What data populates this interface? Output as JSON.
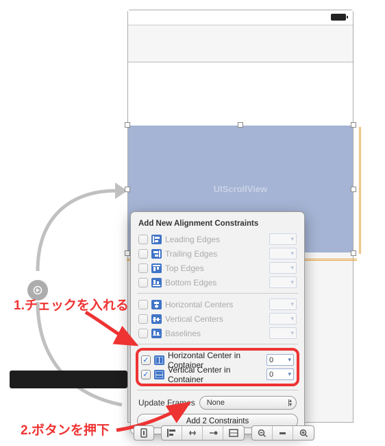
{
  "canvas": {
    "element_label": "UIScrollView"
  },
  "popover": {
    "title": "Add New Alignment Constraints",
    "options": [
      {
        "label": "Leading Edges",
        "checked": false,
        "enabled": false,
        "value": ""
      },
      {
        "label": "Trailing Edges",
        "checked": false,
        "enabled": false,
        "value": ""
      },
      {
        "label": "Top Edges",
        "checked": false,
        "enabled": false,
        "value": ""
      },
      {
        "label": "Bottom Edges",
        "checked": false,
        "enabled": false,
        "value": ""
      },
      {
        "label": "Horizontal Centers",
        "checked": false,
        "enabled": false,
        "value": ""
      },
      {
        "label": "Vertical Centers",
        "checked": false,
        "enabled": false,
        "value": ""
      },
      {
        "label": "Baselines",
        "checked": false,
        "enabled": false,
        "value": ""
      }
    ],
    "container_options": [
      {
        "label": "Horizontal Center in Container",
        "checked": true,
        "enabled": true,
        "value": "0"
      },
      {
        "label": "Vertical Center in Container",
        "checked": true,
        "enabled": true,
        "value": "0"
      }
    ],
    "update_frames_label": "Update Frames",
    "update_frames_value": "None",
    "add_button": "Add 2 Constraints"
  },
  "annotations": {
    "step1": "1.チェックを入れる",
    "step2": "2.ボタンを押下"
  },
  "toolbar": {
    "doc_outline": "document-outline",
    "align": "align",
    "pin": "pin",
    "resolve": "resolve",
    "resize": "resizing",
    "zoom_out": "zoom-out",
    "zoom_fit": "zoom-fit",
    "zoom_in": "zoom-in"
  }
}
